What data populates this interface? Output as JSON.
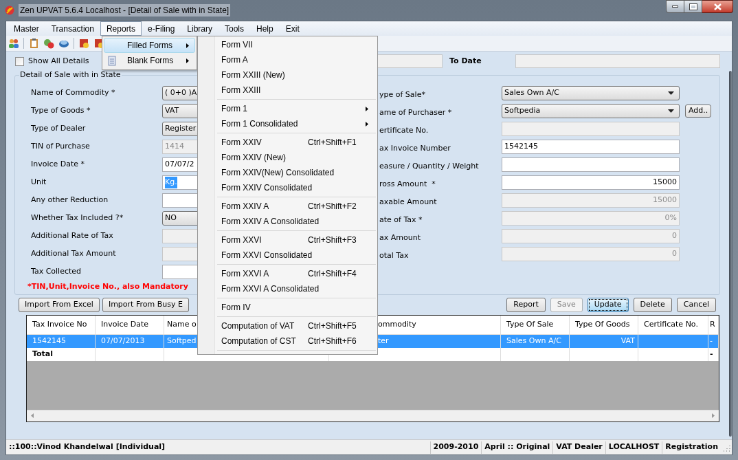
{
  "window": {
    "title": "Zen UPVAT 5.6.4 Localhost - [Detail of Sale with in State]"
  },
  "menu": [
    {
      "label": "Master",
      "selected": false
    },
    {
      "label": "Transaction",
      "selected": false
    },
    {
      "label": "Reports",
      "selected": true
    },
    {
      "label": "e-Filing",
      "selected": false
    },
    {
      "label": "Library",
      "selected": false
    },
    {
      "label": "Tools",
      "selected": false
    },
    {
      "label": "Help",
      "selected": false
    },
    {
      "label": "Exit",
      "selected": false
    }
  ],
  "reports_menu": [
    {
      "label": "Filled Forms",
      "selected": true,
      "has_submenu": true,
      "has_icon": false
    },
    {
      "label": "Blank Forms",
      "selected": false,
      "has_submenu": true,
      "has_icon": true
    }
  ],
  "filled_forms_menu": [
    [
      {
        "label": "Form  VII"
      },
      {
        "label": "Form A"
      },
      {
        "label": "Form XXIII (New)"
      },
      {
        "label": "Form XXIII"
      }
    ],
    [
      {
        "label": "Form 1",
        "has_submenu": true
      },
      {
        "label": "Form 1 Consolidated",
        "has_submenu": true
      }
    ],
    [
      {
        "label": "Form XXIV",
        "shortcut": "Ctrl+Shift+F1"
      },
      {
        "label": "Form XXIV (New)"
      },
      {
        "label": "Form XXIV(New) Consolidated"
      },
      {
        "label": "Form XXIV Consolidated"
      }
    ],
    [
      {
        "label": "Form XXIV A",
        "shortcut": "Ctrl+Shift+F2"
      },
      {
        "label": "Form XXIV A Consolidated"
      }
    ],
    [
      {
        "label": "Form XXVI",
        "shortcut": "Ctrl+Shift+F3"
      },
      {
        "label": "Form XXVI Consolidated"
      }
    ],
    [
      {
        "label": "Form XXVI A",
        "shortcut": "Ctrl+Shift+F4"
      },
      {
        "label": "Form XXVI A Consolidated"
      }
    ],
    [
      {
        "label": "Form IV"
      }
    ],
    [
      {
        "label": "Computation of VAT",
        "shortcut": "Ctrl+Shift+F5"
      },
      {
        "label": "Computation of CST",
        "shortcut": "Ctrl+Shift+F6"
      }
    ]
  ],
  "filter": {
    "show_all": {
      "label": "Show All Details",
      "checked": false
    },
    "to_date": {
      "label": "To Date"
    }
  },
  "detail": {
    "title": "Detail of Sale with in State",
    "left_fields": [
      {
        "label": "Name of Commodity *",
        "kind": "select",
        "value": "( 0+0 )A"
      },
      {
        "label": "Type of Goods *",
        "kind": "select",
        "value": "VAT"
      },
      {
        "label": "Type of Dealer",
        "kind": "select",
        "value": "Register"
      },
      {
        "label": "TIN of Purchase",
        "kind": "disabled",
        "value": "1414"
      },
      {
        "label": "Invoice Date *",
        "kind": "input",
        "value": "07/07/2"
      },
      {
        "label": "Unit",
        "kind": "input",
        "value": "Kg.",
        "highlighted": true
      },
      {
        "label": "Any other Reduction",
        "kind": "input"
      },
      {
        "label": "Whether Tax Included ?*",
        "kind": "select",
        "value": "NO"
      },
      {
        "label": "Additional Rate of Tax",
        "kind": "disabled"
      },
      {
        "label": "Additional Tax Amount",
        "kind": "disabled"
      },
      {
        "label": "Tax Collected",
        "kind": "input"
      }
    ],
    "right_fields": [
      {
        "label": "ype of Sale*",
        "kind": "select",
        "value": "Sales Own A/C"
      },
      {
        "label": "ame of Purchaser *",
        "kind": "select",
        "value": "Softpedia",
        "add_button": "Add.."
      },
      {
        "label": "ertificate No.",
        "kind": "disabled"
      },
      {
        "label": "ax Invoice Number",
        "kind": "input",
        "value": "1542145"
      },
      {
        "label": "easure / Quantity / Weight",
        "kind": "input"
      },
      {
        "label": "ross Amount  *",
        "kind": "input",
        "value": "15000",
        "numeric": true
      },
      {
        "label": "axable Amount",
        "kind": "disabled",
        "value": "15000",
        "numeric": true
      },
      {
        "label": "ate of Tax *",
        "kind": "disabled",
        "value": "0%",
        "numeric": true
      },
      {
        "label": "ax Amount",
        "kind": "disabled",
        "value": "0",
        "numeric": true
      },
      {
        "label": "otal Tax",
        "kind": "disabled",
        "value": "0",
        "numeric": true
      }
    ],
    "note": "*TIN,Unit,Invoice No., also Mandatory"
  },
  "left_buttons": [
    {
      "label": "Import From Excel"
    },
    {
      "label": "Import From Busy E"
    }
  ],
  "right_buttons": [
    {
      "label": "Report",
      "disabled": false,
      "focused": false
    },
    {
      "label": "Save",
      "disabled": true,
      "focused": false
    },
    {
      "label": "Update",
      "disabled": false,
      "focused": true
    },
    {
      "label": "Delete",
      "disabled": false,
      "focused": false
    },
    {
      "label": "Cancel",
      "disabled": false,
      "focused": false
    }
  ],
  "table": {
    "columns": [
      {
        "label": "Tax Invoice No"
      },
      {
        "label": "Invoice Date"
      },
      {
        "label": "Name o"
      },
      {
        "label": "ommodity"
      },
      {
        "label": "Type Of Sale"
      },
      {
        "label": "Type Of Goods",
        "right_aligned": true
      },
      {
        "label": "Certificate No."
      },
      {
        "label": "R"
      }
    ],
    "rows": [
      {
        "kind": "data",
        "selected": true,
        "cells": [
          "1542145",
          "07/07/2013",
          "Softped",
          "ter",
          "Sales Own A/C",
          "VAT",
          null,
          "-"
        ]
      },
      {
        "kind": "total",
        "selected": false,
        "cells": [
          "Total",
          null,
          null,
          null,
          null,
          null,
          null,
          "-"
        ]
      }
    ]
  },
  "status_bar": [
    "::100::Vinod Khandelwal [Individual]",
    "2009-2010",
    "April :: Original",
    "VAT Dealer",
    "LOCALHOST",
    "Registration"
  ]
}
